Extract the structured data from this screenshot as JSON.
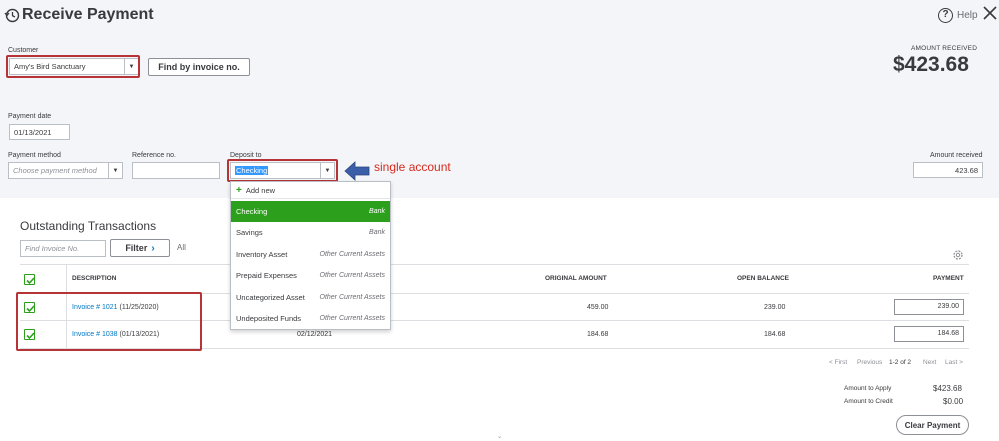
{
  "window": {
    "title": "Receive Payment",
    "help_label": "Help"
  },
  "customer": {
    "label": "Customer",
    "value": "Amy's Bird Sanctuary",
    "find_invoice_button": "Find by invoice no."
  },
  "amount_received_header": {
    "label": "AMOUNT RECEIVED",
    "value": "$423.68"
  },
  "payment_date": {
    "label": "Payment date",
    "value": "01/13/2021"
  },
  "payment_method": {
    "label": "Payment method",
    "placeholder": "Choose payment method"
  },
  "reference_no": {
    "label": "Reference no.",
    "value": ""
  },
  "deposit_to": {
    "label": "Deposit to",
    "value": "Checking",
    "annotation": "single account",
    "dropdown": {
      "add_new_label": "Add new",
      "items": [
        {
          "name": "Checking",
          "type": "Bank"
        },
        {
          "name": "Savings",
          "type": "Bank"
        },
        {
          "name": "Inventory Asset",
          "type": "Other Current Assets"
        },
        {
          "name": "Prepaid Expenses",
          "type": "Other Current Assets"
        },
        {
          "name": "Uncategorized Asset",
          "type": "Other Current Assets"
        },
        {
          "name": "Undeposited Funds",
          "type": "Other Current Assets"
        }
      ]
    }
  },
  "amount_received_field": {
    "label": "Amount received",
    "value": "423.68"
  },
  "outstanding": {
    "title": "Outstanding Transactions",
    "find_placeholder": "Find Invoice No.",
    "filter_label": "Filter",
    "all_label": "All",
    "columns": {
      "description": "DESCRIPTION",
      "original_amount": "ORIGINAL AMOUNT",
      "open_balance": "OPEN BALANCE",
      "payment": "PAYMENT"
    },
    "rows": [
      {
        "invoice_link": "Invoice # 1021",
        "invoice_date": "(11/25/2020)",
        "due_date": "",
        "original_amount": "459.00",
        "open_balance": "239.00",
        "payment": "239.00"
      },
      {
        "invoice_link": "Invoice # 1038",
        "invoice_date": "(01/13/2021)",
        "due_date": "02/12/2021",
        "original_amount": "184.68",
        "open_balance": "184.68",
        "payment": "184.68"
      }
    ],
    "pager": {
      "first": "< First",
      "previous": "Previous",
      "range": "1-2 of 2",
      "next": "Next",
      "last": "Last >"
    }
  },
  "summary": {
    "amount_to_apply_label": "Amount to Apply",
    "amount_to_apply_value": "$423.68",
    "amount_to_credit_label": "Amount to Credit",
    "amount_to_credit_value": "$0.00",
    "clear_payment_label": "Clear Payment"
  },
  "colors": {
    "accent_green": "#2ca01c",
    "link_blue": "#0077c5",
    "annotation_red": "#d52b1e",
    "annotation_box": "#b63336",
    "annotation_arrow": "#3b5ea8"
  }
}
